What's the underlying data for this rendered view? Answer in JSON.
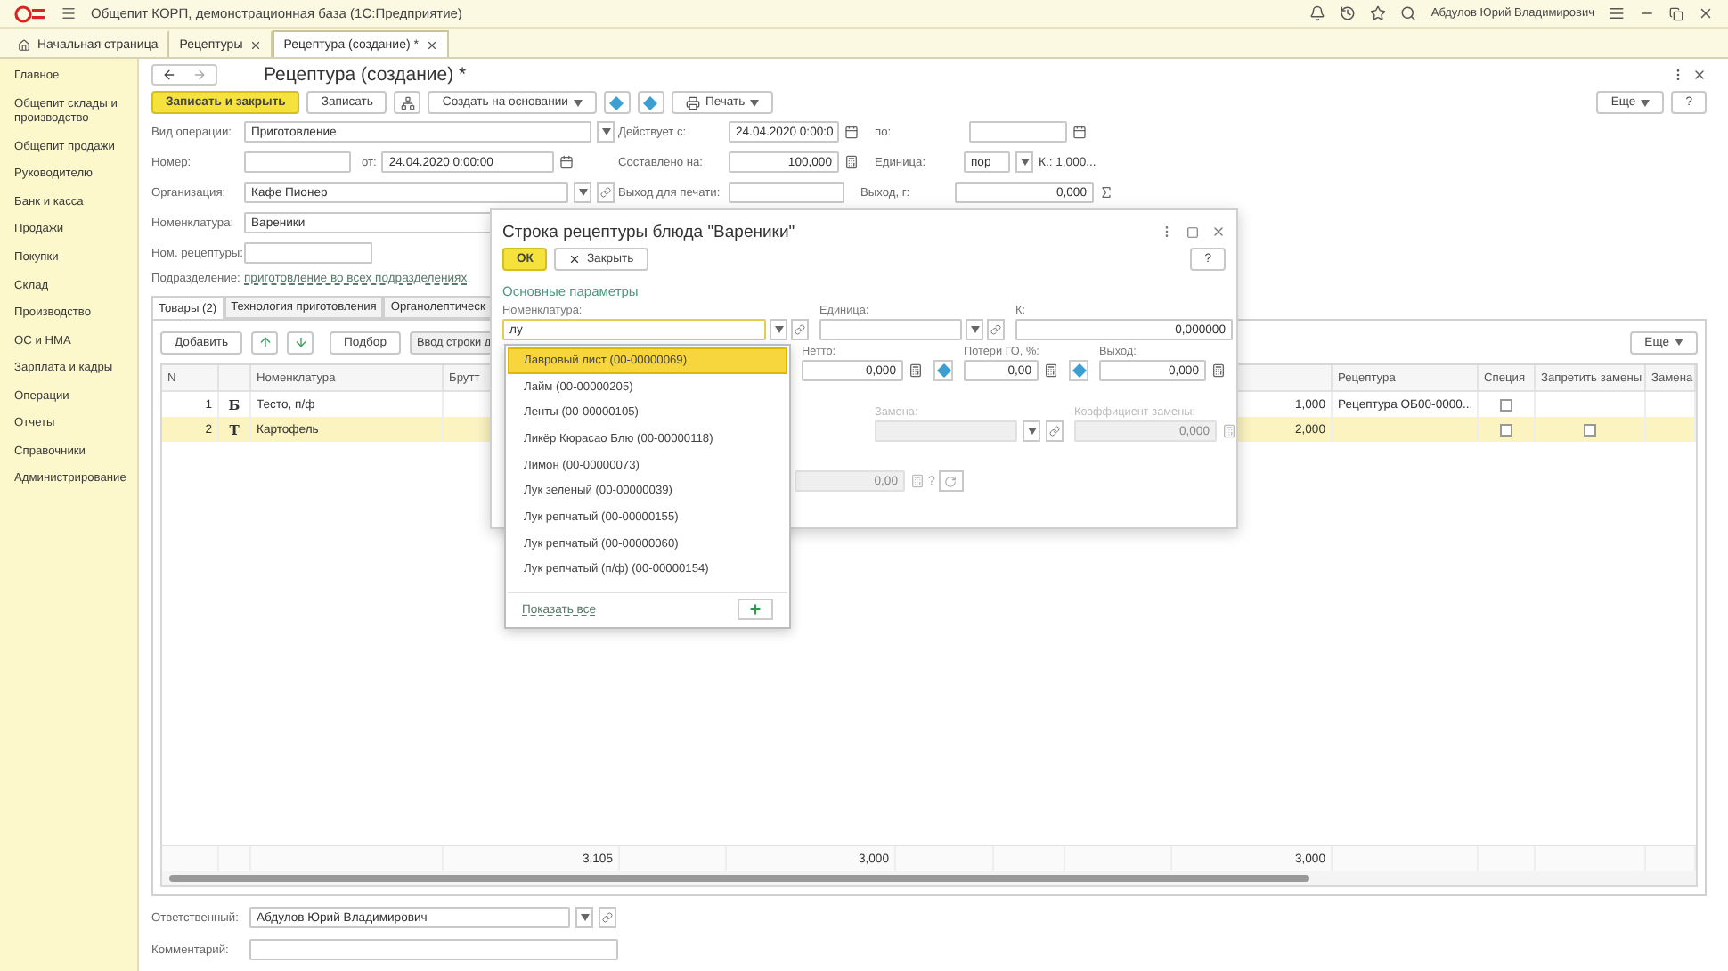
{
  "window": {
    "title": "Общепит КОРП, демонстрационная база  (1С:Предприятие)",
    "user": "Абдулов Юрий Владимирович"
  },
  "open_tabs": [
    {
      "label": "Начальная страница",
      "selected": false,
      "kind": "home"
    },
    {
      "label": "Рецептуры",
      "selected": false,
      "kind": "closable"
    },
    {
      "label": "Рецептура (создание) *",
      "selected": true,
      "kind": "closable"
    }
  ],
  "sidebar": {
    "items": [
      "Главное",
      "Общепит склады и производство",
      "Общепит продажи",
      "Руководителю",
      "Банк и касса",
      "Продажи",
      "Покупки",
      "Склад",
      "Производство",
      "ОС и НМА",
      "Зарплата и кадры",
      "Операции",
      "Отчеты",
      "Справочники",
      "Администрирование"
    ]
  },
  "form": {
    "title": "Рецептура (создание) *",
    "more": "Еще",
    "help": "?",
    "toolbar": [
      {
        "kind": "primary",
        "label": "Записать и закрыть"
      },
      {
        "kind": "plain",
        "label": "Записать"
      },
      {
        "kind": "structure"
      },
      {
        "kind": "menu",
        "label": "Создать на основании"
      },
      {
        "kind": "diamond"
      },
      {
        "kind": "diamond"
      },
      {
        "kind": "print",
        "label": "Печать"
      }
    ],
    "operation": {
      "label": "Вид операции:",
      "value": "Приготовление"
    },
    "valid_from": {
      "label": "Действует с:",
      "value": "24.04.2020  0:00:0"
    },
    "valid_to": {
      "label": "по:"
    },
    "number": {
      "label": "Номер:"
    },
    "date": {
      "label": "от:",
      "value": "24.04.2020  0:00:00"
    },
    "portions": {
      "label": "Составлено на:",
      "value": "100,000"
    },
    "unit": {
      "label": "Единица:",
      "value": "пор",
      "ratio": "К.: 1,000..."
    },
    "organization": {
      "label": "Организация:",
      "value": "Кафе Пионер"
    },
    "print_output": {
      "label": "Выход для печати:"
    },
    "output": {
      "label": "Выход, г:",
      "value": "0,000"
    },
    "item": {
      "label": "Номенклатура:",
      "value": "Вареники"
    },
    "recipe_no": {
      "label": "Ном. рецептуры:"
    },
    "department": {
      "label": "Подразделение:",
      "link": "приготовление во всех подразделениях"
    },
    "tabs": [
      {
        "label": "Товары (2)",
        "selected": true
      },
      {
        "label": "Технология приготовления",
        "selected": false
      },
      {
        "label": "Органолептическ",
        "selected": false
      }
    ],
    "table": {
      "add": "Добавить",
      "pick": "Подбор",
      "enter": "Ввод строки д",
      "more": "Еще",
      "columns": [
        {
          "label": "N"
        },
        {
          "label": "Номенклатура"
        },
        {
          "label": "Брутт"
        },
        {
          "label": "Рецептура"
        },
        {
          "label": "Специя"
        },
        {
          "label": "Запретить замены"
        },
        {
          "label": "Замена"
        }
      ],
      "rows": [
        {
          "n": "1",
          "type": "Б",
          "name": "Тесто, п/ф",
          "qty": "1,000",
          "recipe": "Рецептура ОБ00-0000...",
          "spice": false,
          "selected": false
        },
        {
          "n": "2",
          "type": "Т",
          "name": "Картофель",
          "qty": "2,000",
          "spice": false,
          "forbid_replace": false,
          "selected": true
        }
      ],
      "totals": [
        "3,105",
        "3,000",
        "3,000"
      ]
    },
    "responsible": {
      "label": "Ответственный:",
      "value": "Абдулов Юрий Владимирович"
    },
    "comment": {
      "label": "Комментарий:"
    }
  },
  "dialog": {
    "title": "Строка рецептуры блюда \"Вареники\"",
    "ok": "ОК",
    "close": "Закрыть",
    "help": "?",
    "section": "Основные параметры",
    "item": {
      "label": "Номенклатура:",
      "value": "лу"
    },
    "unit": {
      "label": "Единица:"
    },
    "coef": {
      "label": "К:",
      "value": "0,000000"
    },
    "net": {
      "label": "Нетто:",
      "value": "0,000"
    },
    "loss": {
      "label": "Потери ГО, %:",
      "value": "0,00"
    },
    "out": {
      "label": "Выход:",
      "value": "0,000"
    },
    "replacement": {
      "label": "Замена:",
      "disabled": true
    },
    "replace_coef": {
      "label": "Коэффициент замены:",
      "value": "0,000",
      "disabled": true
    },
    "extra": {
      "value": "0,00",
      "help": "?",
      "disabled": true
    },
    "suggestions": {
      "show_all": "Показать все",
      "items": [
        {
          "label": "Лавровый лист (00-00000069)",
          "selected": true
        },
        {
          "label": "Лайм (00-00000205)",
          "selected": false
        },
        {
          "label": "Ленты (00-00000105)",
          "selected": false
        },
        {
          "label": "Ликёр Кюрасао Блю (00-00000118)",
          "selected": false
        },
        {
          "label": "Лимон (00-00000073)",
          "selected": false
        },
        {
          "label": "Лук зеленый (00-00000039)",
          "selected": false
        },
        {
          "label": "Лук репчатый (00-00000155)",
          "selected": false
        },
        {
          "label": "Лук репчатый (00-00000060)",
          "selected": false
        },
        {
          "label": "Лук репчатый (п/ф) (00-00000154)",
          "selected": false
        }
      ]
    }
  }
}
